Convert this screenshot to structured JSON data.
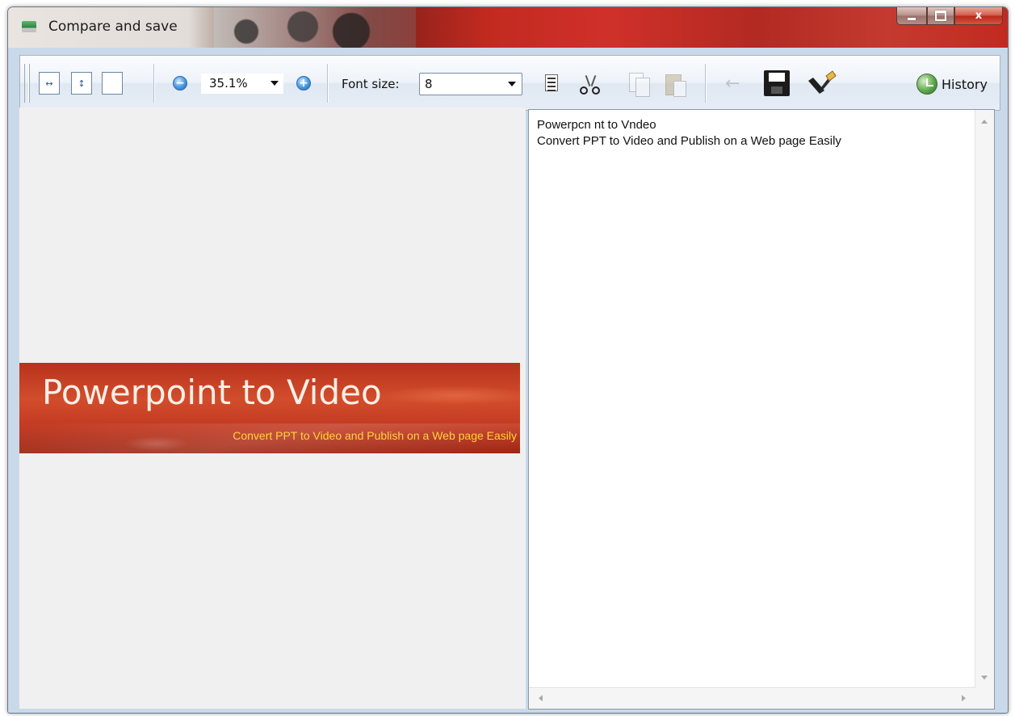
{
  "window": {
    "title": "Compare and save",
    "close_glyph": "x"
  },
  "toolbar": {
    "zoom_value": "35.1%",
    "font_size_label": "Font size:",
    "font_size_value": "8",
    "history_label": "History",
    "undo_glyph": "←"
  },
  "icons": [
    "fit-width-icon",
    "fit-height-icon",
    "fit-page-icon",
    "zoom-out-icon",
    "zoom-in-icon",
    "document-icon",
    "find-icon",
    "copy-icon",
    "paste-icon",
    "undo-icon",
    "save-icon",
    "clean-icon",
    "history-icon"
  ],
  "image_preview": {
    "title": "Powerpoint to Video",
    "subtitle": "Convert PPT to Video and Publish on a Web page Easily"
  },
  "ocr_text": {
    "lines": [
      "Powerpcn nt to Vndeo",
      "Convert PPT to Video and Publish on a Web page Easily"
    ]
  },
  "colors": {
    "banner_red": "#c33a22",
    "banner_subtitle": "#ffd33a",
    "pane_background": "#f0f0f0"
  }
}
